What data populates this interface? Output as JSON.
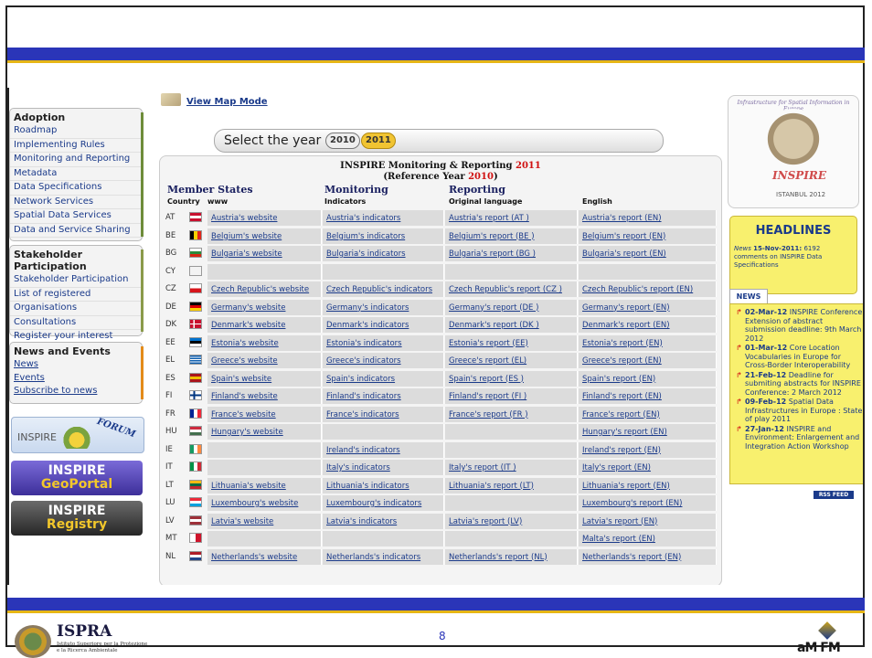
{
  "sidebar": {
    "adoption": {
      "title": "Adoption",
      "items": [
        "Roadmap",
        "Implementing Rules",
        "Monitoring and Reporting",
        "Metadata",
        "Data Specifications",
        "Network Services",
        "Spatial Data Services",
        "Data and Service Sharing"
      ]
    },
    "stakeholder": {
      "title": "Stakeholder Participation",
      "items": [
        "Stakeholder Participation",
        "List of registered",
        "Organisations",
        "Consultations",
        "Register your interest"
      ]
    },
    "news_events": {
      "title": "News and Events",
      "items": [
        "News",
        "Events",
        "Subscribe to news"
      ]
    },
    "banners": {
      "forum_text": "INSPIRE",
      "forum_word": "FORUM",
      "geoportal_line1": "INSPIRE",
      "geoportal_line2": "GeoPortal",
      "registry_line1": "INSPIRE",
      "registry_line2": "Registry"
    }
  },
  "map_mode_label": "View Map Mode",
  "year_selector": {
    "label": "Select the year",
    "years": [
      "2010",
      "2011"
    ],
    "selected": "2011"
  },
  "table": {
    "title_prefix": "INSPIRE Monitoring & Reporting",
    "title_year": "2011",
    "subtitle_prefix": "(Reference Year",
    "subtitle_year": "2010",
    "subtitle_suffix": ")",
    "groups": [
      "Member States",
      "Monitoring",
      "Reporting"
    ],
    "subheaders": [
      "Country",
      "www",
      "Indicators",
      "Original language",
      "English"
    ],
    "rows": [
      {
        "code": "AT",
        "www": "Austria's website",
        "ind": "Austria's indicators",
        "orig": "Austria's report (AT )",
        "en": "Austria's report (EN)"
      },
      {
        "code": "BE",
        "www": "Belgium's website",
        "ind": "Belgium's indicators",
        "orig": "Belgium's report (BE )",
        "en": "Belgium's report (EN)"
      },
      {
        "code": "BG",
        "www": "Bulgaria's website",
        "ind": "Bulgaria's indicators",
        "orig": "Bulgaria's report (BG )",
        "en": "Bulgaria's report (EN)"
      },
      {
        "code": "CY",
        "www": "",
        "ind": "",
        "orig": "",
        "en": ""
      },
      {
        "code": "CZ",
        "www": "Czech Republic's website",
        "ind": "Czech Republic's indicators",
        "orig": "Czech Republic's report (CZ )",
        "en": "Czech Republic's report (EN)"
      },
      {
        "code": "DE",
        "www": "Germany's website",
        "ind": "Germany's indicators",
        "orig": "Germany's report (DE )",
        "en": "Germany's report (EN)"
      },
      {
        "code": "DK",
        "www": "Denmark's website",
        "ind": "Denmark's indicators",
        "orig": "Denmark's report (DK )",
        "en": "Denmark's report (EN)"
      },
      {
        "code": "EE",
        "www": "Estonia's website",
        "ind": "Estonia's indicators",
        "orig": "Estonia's report (EE)",
        "en": "Estonia's report (EN)"
      },
      {
        "code": "EL",
        "www": "Greece's website",
        "ind": "Greece's indicators",
        "orig": "Greece's report (EL)",
        "en": "Greece's report (EN)"
      },
      {
        "code": "ES",
        "www": "Spain's website",
        "ind": "Spain's indicators",
        "orig": "Spain's report (ES )",
        "en": "Spain's report (EN)"
      },
      {
        "code": "FI",
        "www": "Finland's website",
        "ind": "Finland's indicators",
        "orig": "Finland's report (FI )",
        "en": "Finland's report (EN)"
      },
      {
        "code": "FR",
        "www": "France's website",
        "ind": "France's indicators",
        "orig": "France's report (FR )",
        "en": "France's report (EN)"
      },
      {
        "code": "HU",
        "www": "Hungary's website",
        "ind": "",
        "orig": "",
        "en": "Hungary's report (EN)"
      },
      {
        "code": "IE",
        "www": "",
        "ind": "Ireland's indicators",
        "orig": "",
        "en": "Ireland's report (EN)"
      },
      {
        "code": "IT",
        "www": "",
        "ind": "Italy's indicators",
        "orig": "Italy's report (IT )",
        "en": "Italy's report (EN)"
      },
      {
        "code": "LT",
        "www": "Lithuania's website",
        "ind": "Lithuania's indicators",
        "orig": "Lithuania's report (LT)",
        "en": "Lithuania's report (EN)"
      },
      {
        "code": "LU",
        "www": "Luxembourg's website",
        "ind": "Luxembourg's indicators",
        "orig": "",
        "en": "Luxembourg's report (EN)"
      },
      {
        "code": "LV",
        "www": "Latvia's website",
        "ind": "Latvia's indicators",
        "orig": "Latvia's report (LV)",
        "en": "Latvia's report (EN)"
      },
      {
        "code": "MT",
        "www": "",
        "ind": "",
        "orig": "",
        "en": "Malta's report (EN)"
      },
      {
        "code": "NL",
        "www": "Netherlands's website",
        "ind": "Netherlands's indicators",
        "orig": "Netherlands's report (NL)",
        "en": "Netherlands's report (EN)"
      }
    ]
  },
  "right_panel": {
    "logo_arc": "Infrastructure for Spatial Information in Europe",
    "logo_word": "INSPIRE",
    "logo_sub": "ISTANBUL 2012",
    "headlines_title": "HEADLINES",
    "headline_prefix": "News",
    "headline_date": "15-Nov-2011:",
    "headline_text": "6192 comments on INSPIRE Data Specifications",
    "news_tab": "NEWS",
    "news": [
      {
        "date": "02-Mar-12",
        "text": "INSPIRE Conference: Extension of abstract submission deadline: 9th March 2012"
      },
      {
        "date": "01-Mar-12",
        "text": "Core Location Vocabularies in Europe for Cross-Border Interoperability"
      },
      {
        "date": "21-Feb-12",
        "text": "Deadline for submiting abstracts for INSPIRE Conference: 2 March 2012"
      },
      {
        "date": "09-Feb-12",
        "text": "Spatial Data Infrastructures in Europe : State of play 2011"
      },
      {
        "date": "27-Jan-12",
        "text": "INSPIRE and Environment: Enlargement and Integration Action Workshop"
      }
    ],
    "rss_label": "RSS",
    "feed_label": "FEED"
  },
  "footer": {
    "ispra_name": "ISPRA",
    "ispra_sub1": "Istituto Superiore per la Protezione",
    "ispra_sub2": "e la Ricerca Ambientale",
    "page_number": "8",
    "amfm_logo": "aM FM"
  },
  "colors": {
    "bar_blue": "#2a35b8",
    "bar_gold": "#e6b616",
    "link": "#1a3a8a",
    "accent_red": "#d01010",
    "headline_yellow": "#f8f06e"
  }
}
